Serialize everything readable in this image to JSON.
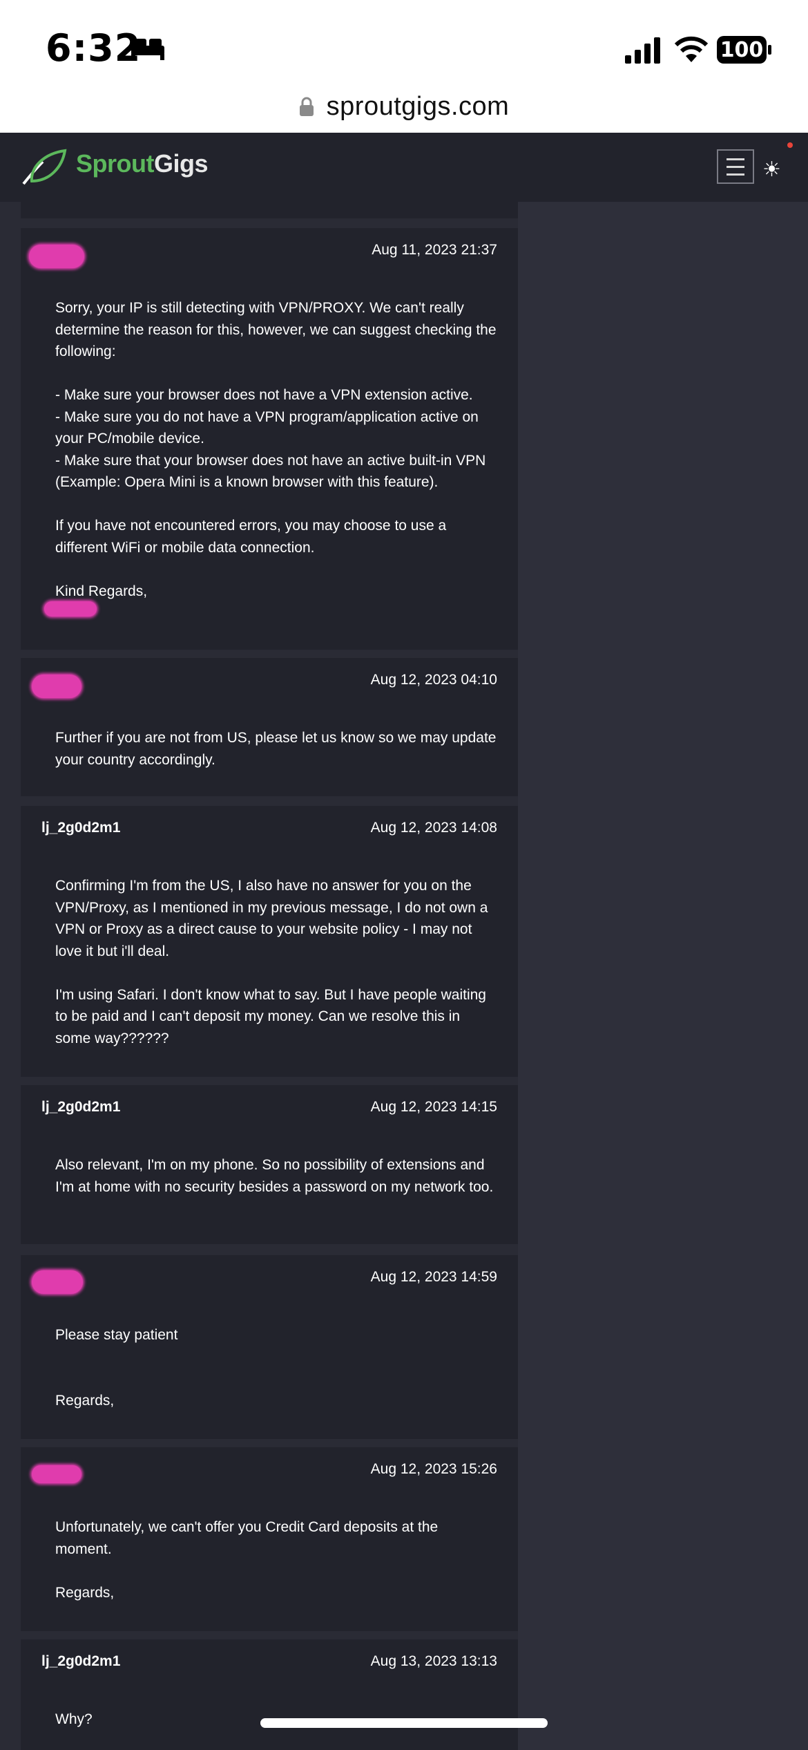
{
  "status_bar": {
    "time": "6:32",
    "battery": "100",
    "icons": [
      "bed-icon",
      "signal-icon",
      "wifi-icon",
      "battery-icon"
    ]
  },
  "browser": {
    "url": "sproutgigs.com",
    "lock_icon": "lock-icon"
  },
  "header": {
    "logo_part1": "Sprout",
    "logo_part2": "Gigs",
    "menu_icon": "hamburger-icon",
    "theme_icon": "sun-icon",
    "brand_color": "#5cb85c"
  },
  "messages": [
    {
      "author": "",
      "redacted": true,
      "date": "Aug 11, 2023 21:37",
      "body": "Sorry, your IP is still detecting with VPN/PROXY. We can't really determine the reason for this, however, we can suggest checking the following:\n\n- Make sure your browser does not have a VPN extension active.\n- Make sure you do not have a VPN program/application active on your PC/mobile device.\n- Make sure that your browser does not have an active built-in VPN (Example: Opera Mini is a known browser with this feature).\n\nIf you have not encountered errors, you may choose to use a different WiFi or mobile data connection.\n\nKind Regards,"
    },
    {
      "author": "",
      "redacted": true,
      "date": "Aug 12, 2023 04:10",
      "body": "Further if you are not from US, please let us know so we may update your country accordingly."
    },
    {
      "author": "lj_2g0d2m1",
      "redacted": false,
      "date": "Aug 12, 2023 14:08",
      "body": "Confirming I'm from the US, I also have no answer for you on the VPN/Proxy, as I mentioned in my previous message, I do not own a VPN or Proxy as a direct cause to your website policy - I may not love it but i'll deal.\n\nI'm using Safari. I don't know what to say. But I have people waiting to be paid and I can't deposit my money. Can we resolve this in some way??????"
    },
    {
      "author": "lj_2g0d2m1",
      "redacted": false,
      "date": "Aug 12, 2023 14:15",
      "body": "Also relevant, I'm on my phone. So no possibility of extensions and I'm at home with no security besides a password on my network too."
    },
    {
      "author": "",
      "redacted": true,
      "date": "Aug 12, 2023 14:59",
      "body": "Please stay patient\n\n\nRegards,"
    },
    {
      "author": "",
      "redacted": true,
      "date": "Aug 12, 2023 15:26",
      "body": "Unfortunately, we can't offer you Credit Card deposits at the moment.\n\nRegards,"
    },
    {
      "author": "lj_2g0d2m1",
      "redacted": false,
      "date": "Aug 13, 2023 13:13",
      "body": "Why?"
    }
  ]
}
